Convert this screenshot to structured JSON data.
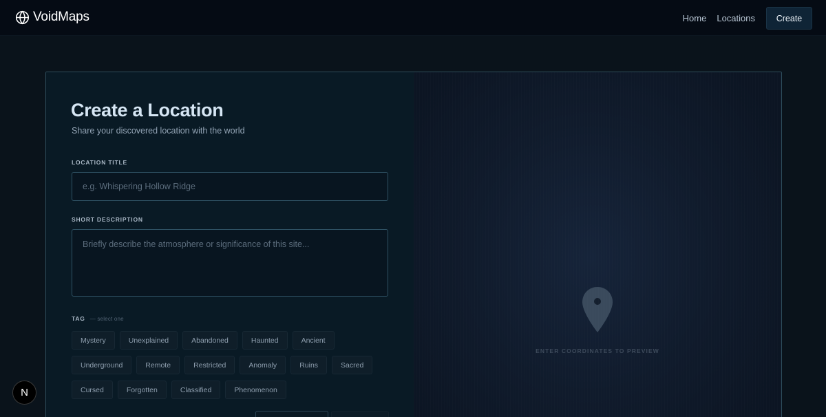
{
  "nav": {
    "brand": "VoidMaps",
    "links": [
      "Home",
      "Locations"
    ],
    "create_label": "Create"
  },
  "form": {
    "title": "Create a Location",
    "subtitle": "Share your discovered location with the world",
    "title_label": "LOCATION TITLE",
    "title_placeholder": "e.g. Whispering Hollow Ridge",
    "desc_label": "SHORT DESCRIPTION",
    "desc_placeholder": "Briefly describe the atmosphere or significance of this site...",
    "tag_label": "TAG",
    "tag_hint": "— select one",
    "tags": [
      [
        "Mystery",
        "Unexplained",
        "Abandoned",
        "Haunted",
        "Ancient"
      ],
      [
        "Underground",
        "Remote",
        "Restricted",
        "Anomaly",
        "Ruins",
        "Sacred"
      ],
      [
        "Cursed",
        "Forgotten",
        "Classified",
        "Phenomenon"
      ]
    ]
  },
  "preview": {
    "caption": "ENTER COORDINATES TO PREVIEW",
    "icon": "map-pin-icon"
  },
  "badge": {
    "letter": "N"
  },
  "colors": {
    "background": "#0a131b",
    "navbar": "#050b14",
    "card_border": "#2e4d5c",
    "accent_button": "#0f2436"
  }
}
